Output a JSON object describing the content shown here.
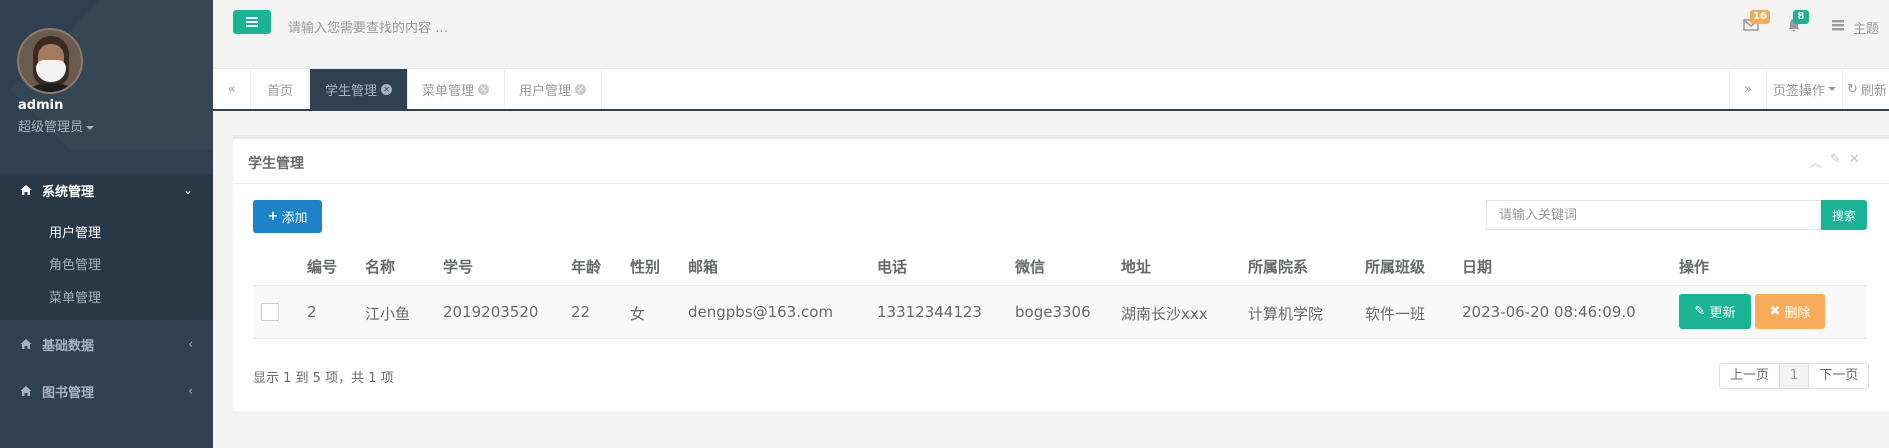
{
  "sidebar": {
    "user_name": "admin",
    "role": "超级管理员",
    "menus": [
      {
        "label": "系统管理",
        "arrow": "⌄"
      },
      {
        "label": "基础数据",
        "arrow": "‹"
      },
      {
        "label": "图书管理",
        "arrow": "‹"
      }
    ],
    "submenu": [
      "用户管理",
      "角色管理",
      "菜单管理"
    ]
  },
  "topbar": {
    "search_placeholder": "请输入您需要查找的内容 …",
    "mail_count": "16",
    "bell_count": "8",
    "theme_label": "主题",
    "mail_badge_color": "#f8ac59",
    "bell_badge_color": "#1ab394"
  },
  "tabs": {
    "items": [
      "首页",
      "学生管理",
      "菜单管理",
      "用户管理"
    ],
    "tab_ops": "页签操作",
    "refresh": "刷新"
  },
  "panel": {
    "title": "学生管理",
    "add_label": "添加",
    "keyword_placeholder": "请输入关键词",
    "search_label": "搜索",
    "columns": [
      "编号",
      "名称",
      "学号",
      "年龄",
      "性别",
      "邮箱",
      "电话",
      "微信",
      "地址",
      "所属院系",
      "所属班级",
      "日期",
      "操作"
    ],
    "rows": [
      {
        "id": "2",
        "name": "江小鱼",
        "student_no": "2019203520",
        "age": "22",
        "gender": "女",
        "email": "dengpbs@163.com",
        "phone": "13312344123",
        "wechat": "boge3306",
        "address": "湖南长沙xxx",
        "department": "计算机学院",
        "class": "软件一班",
        "date": "2023-06-20 08:46:09.0",
        "update_label": "更新",
        "delete_label": "删除"
      }
    ],
    "summary": "显示 1 到 5 项，共 1 项",
    "pager": {
      "prev": "上一页",
      "current": "1",
      "next": "下一页"
    }
  },
  "colors": {
    "sidebar_bg": "#2f4050",
    "primary": "#1ab394",
    "blue": "#1c84c6",
    "warning": "#f8ac59"
  }
}
